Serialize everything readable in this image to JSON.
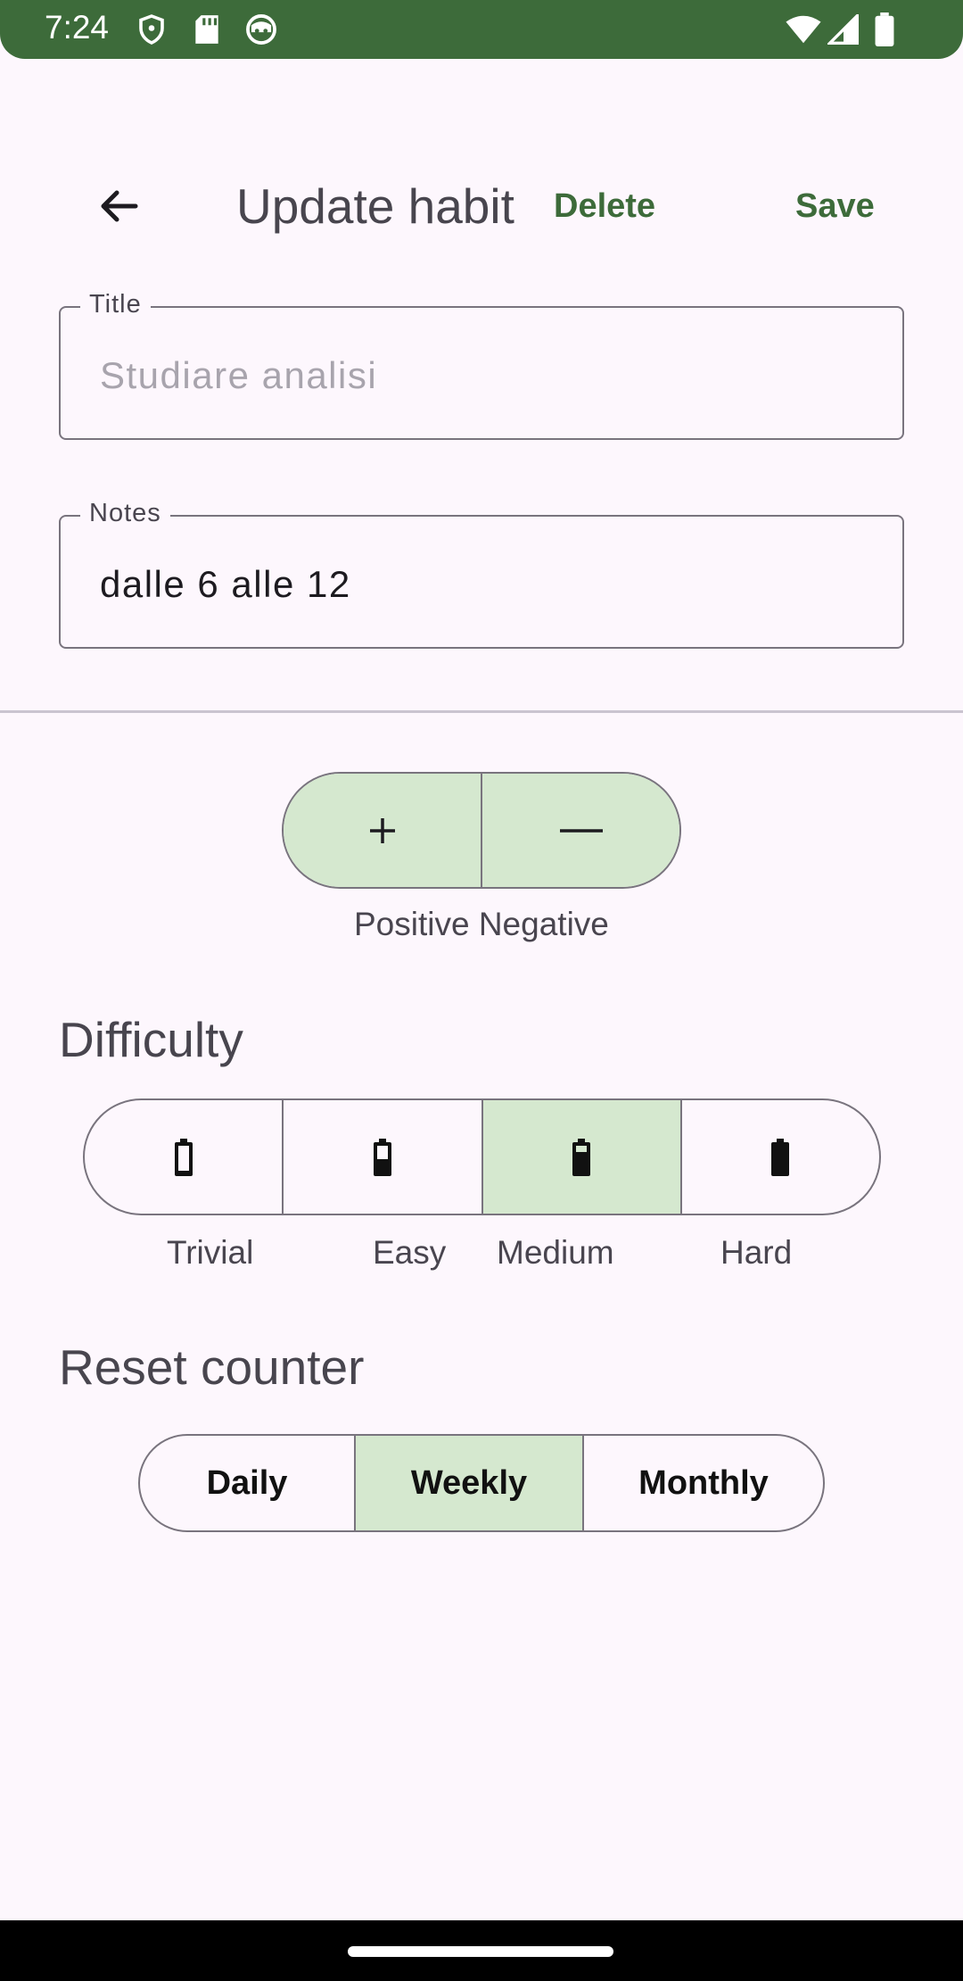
{
  "status_bar": {
    "time": "7:24",
    "left_icons": [
      "shield-icon",
      "sd-card-icon",
      "robot-face-icon"
    ],
    "right_icons": [
      "wifi-icon",
      "cell-signal-icon",
      "battery-icon"
    ]
  },
  "app_bar": {
    "back_icon": "arrow-back-icon",
    "title": "Update habit",
    "delete_label": "Delete",
    "save_label": "Save"
  },
  "form": {
    "title_label": "Title",
    "title_placeholder": "Studiare analisi",
    "notes_label": "Notes",
    "notes_value": "dalle 6 alle 12"
  },
  "habit_type": {
    "options": [
      {
        "icon": "plus-icon",
        "selected": true
      },
      {
        "icon": "minus-icon",
        "selected": true
      }
    ],
    "caption": "Positive Negative"
  },
  "difficulty": {
    "title": "Difficulty",
    "options": [
      {
        "label": "Trivial",
        "icon": "battery-low-icon",
        "selected": false
      },
      {
        "label": "Easy",
        "icon": "battery-half-icon",
        "selected": false
      },
      {
        "label": "Medium",
        "icon": "battery-high-icon",
        "selected": true
      },
      {
        "label": "Hard",
        "icon": "battery-full-icon",
        "selected": false
      }
    ]
  },
  "reset_counter": {
    "title": "Reset counter",
    "options": [
      {
        "label": "Daily",
        "selected": false
      },
      {
        "label": "Weekly",
        "selected": true
      },
      {
        "label": "Monthly",
        "selected": false
      }
    ]
  },
  "colors": {
    "accent": "#3d6b3a",
    "selected_fill": "#d5e8cf",
    "background": "#fdf7fd",
    "outline": "#79747e"
  }
}
